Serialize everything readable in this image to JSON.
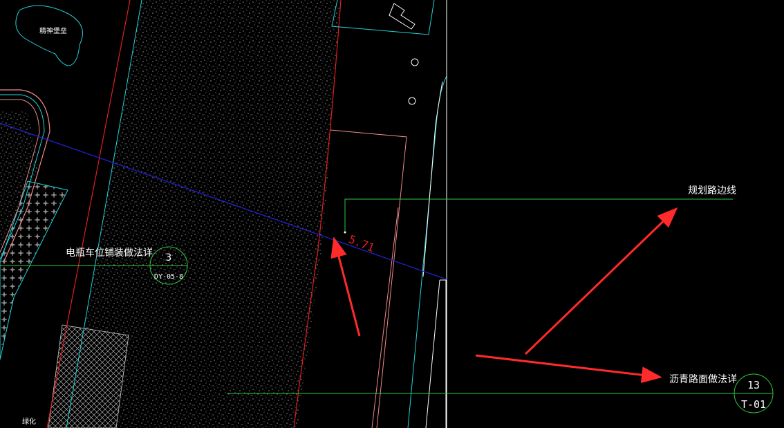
{
  "labels": {
    "green_space_top": "精神堡垒",
    "green_space_bottom": "绿化",
    "ev_parking_note": "电瓶车位铺装做法详",
    "planned_road_edge": "规划路边线",
    "asphalt_note": "沥青路面做法详",
    "dimension": "5.71"
  },
  "detail_callouts": [
    {
      "number": "3",
      "sheet": "DY-05-8"
    },
    {
      "number": "13",
      "sheet": "T-01"
    }
  ],
  "colors": {
    "background": "#000000",
    "cyan": "#22d3d8",
    "red": "#e02020",
    "pink": "#f28a8a",
    "green": "#2ecc40",
    "blue": "#2020d0",
    "white": "#ffffff",
    "arrow": "#ff2a2a"
  }
}
